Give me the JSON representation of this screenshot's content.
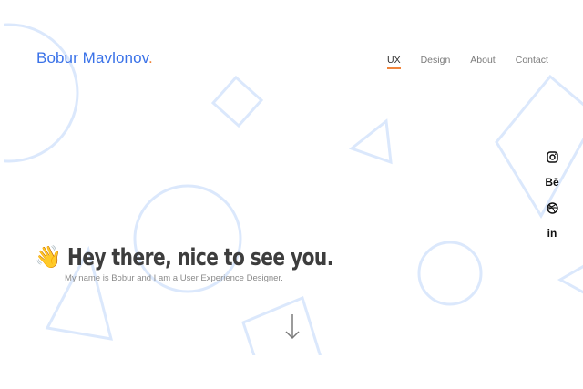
{
  "header": {
    "logo_text": "Bobur Mavlonov",
    "logo_dot": "."
  },
  "nav": {
    "items": [
      {
        "label": "UX",
        "active": true
      },
      {
        "label": "Design",
        "active": false
      },
      {
        "label": "About",
        "active": false
      },
      {
        "label": "Contact",
        "active": false
      }
    ]
  },
  "social": {
    "icons": [
      "instagram-icon",
      "behance-icon",
      "dribbble-icon",
      "linkedin-icon"
    ],
    "behance_label": "Bē",
    "linkedin_label": "in"
  },
  "hero": {
    "wave_emoji": "👋",
    "greeting": "Hey there, nice to see you.",
    "subtitle": "My name is Bobur and I am a User Experience Designer."
  },
  "colors": {
    "accent_blue": "#3a72e8",
    "accent_orange": "#f0843a",
    "shape_stroke": "#dbe8fc",
    "text_dark": "#3d3d3d"
  }
}
